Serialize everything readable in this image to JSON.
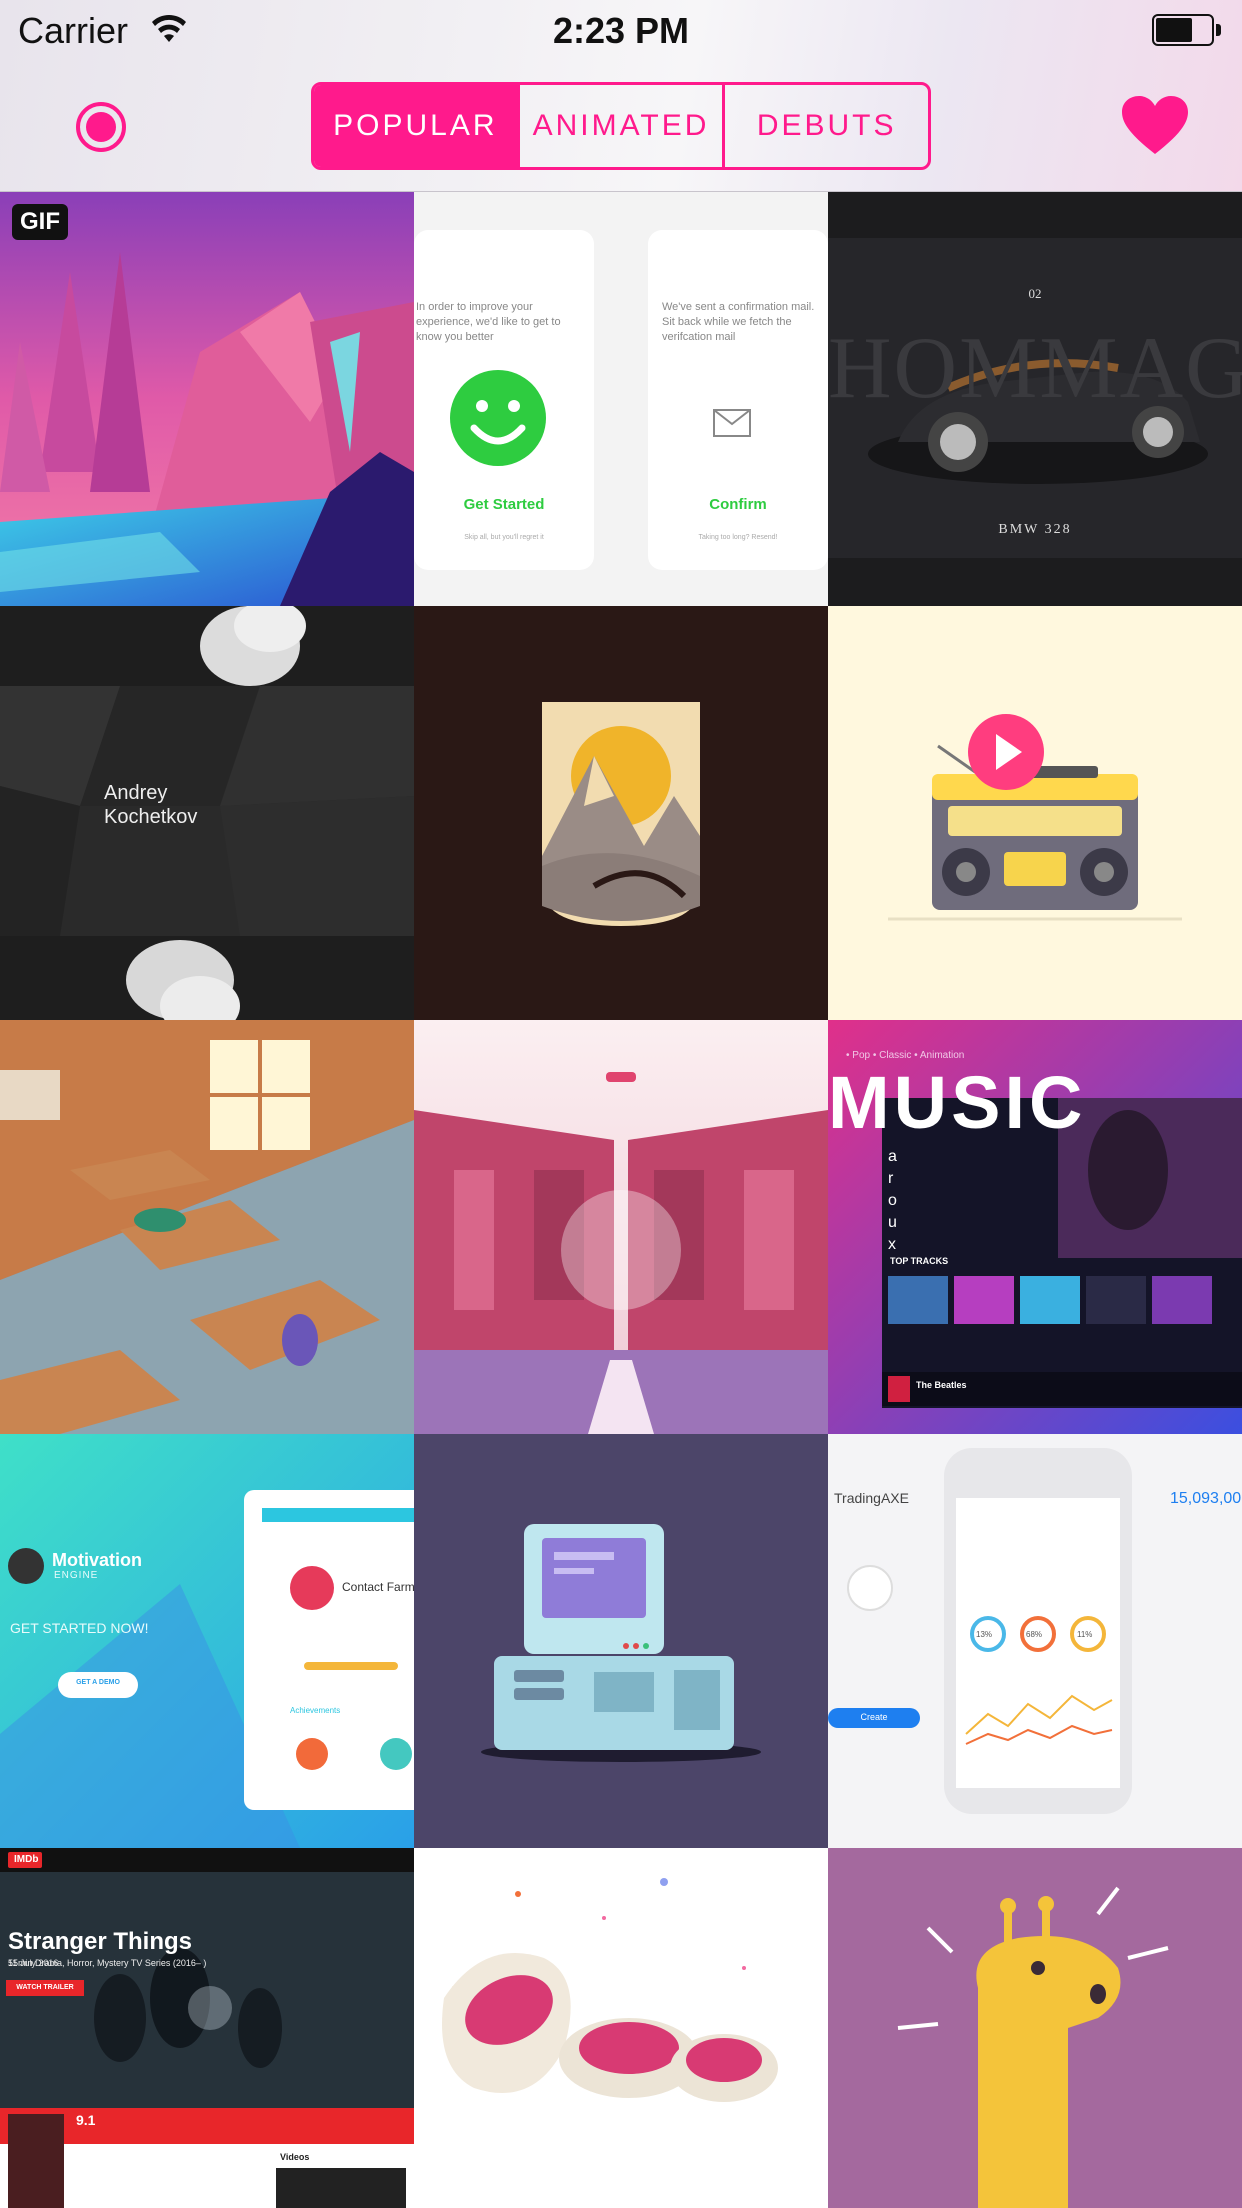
{
  "status_bar": {
    "carrier": "Carrier",
    "time": "2:23 PM"
  },
  "header": {
    "tabs": [
      {
        "label": "POPULAR",
        "active": true
      },
      {
        "label": "ANIMATED",
        "active": false
      },
      {
        "label": "DEBUTS",
        "active": false
      }
    ],
    "record_icon": "record-icon",
    "favorite_icon": "heart-icon",
    "accent_color": "#ff1a8c"
  },
  "shots": {
    "gif_badge": "GIF",
    "onboarding": {
      "text_left": "In order to improve your experience, we'd like to get to know you better",
      "cta_left": "Get Started",
      "sub_left": "Skip all, but you'll regret it",
      "text_right": "We've sent a confirmation mail. Sit back while we fetch the verifcation mail",
      "cta_right": "Confirm",
      "sub_right": "Taking too long? Resend!"
    },
    "car": {
      "number": "02",
      "bg_word": "HOMMAGE",
      "model": "BMW 328"
    },
    "portfolio": {
      "name_line1": "Andrey",
      "name_line2": "Kochetkov"
    },
    "music": {
      "breadcrumb": "• Pop • Classic • Animation",
      "title": "MUSIC",
      "artist": "aroux",
      "section": "TOP TRACKS",
      "now_playing": "The Beatles"
    },
    "motivation": {
      "brand": "Motivation",
      "subbrand": "ENGINE",
      "cta": "GET STARTED NOW!",
      "button": "GET A DEMO",
      "card_title": "Contact Farm",
      "card_section": "Achievements"
    },
    "trading": {
      "brand": "TradingAXE",
      "balance": "15,093,00",
      "button": "Create",
      "stats": [
        "13%",
        "68%",
        "11%"
      ]
    },
    "imdb": {
      "logo": "IMDb",
      "date": "11 July 2016",
      "title": "Stranger Things",
      "meta": "55min  Drama, Horror, Mystery  TV Series (2016– )",
      "button": "WATCH TRAILER",
      "rating": "9.1",
      "videos": "Videos"
    }
  }
}
